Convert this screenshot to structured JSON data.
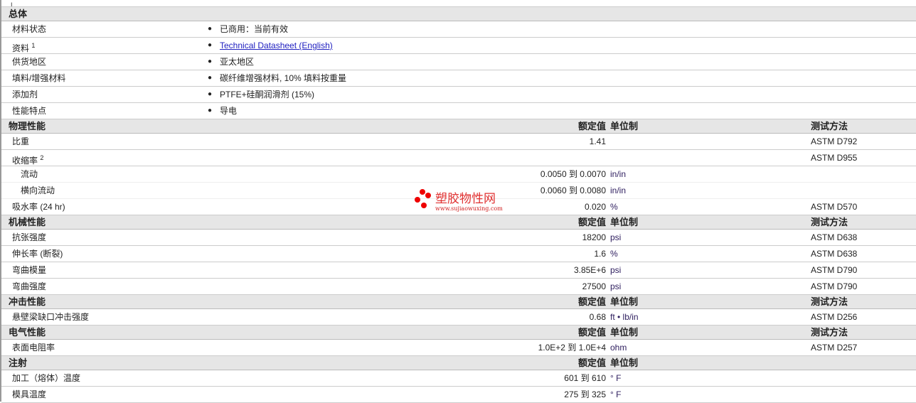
{
  "general": {
    "title": "总体",
    "rows": [
      {
        "label": "材料状态",
        "value": "已商用：当前有效"
      },
      {
        "label": "资料",
        "sup": "1",
        "value": "Technical Datasheet (English)",
        "link": true
      },
      {
        "label": "供货地区",
        "value": "亚太地区"
      },
      {
        "label": "填料/增强材料",
        "value": "碳纤维增强材料, 10% 填料按重量"
      },
      {
        "label": "添加剂",
        "value": "PTFE+硅酮润滑剂 (15%)"
      },
      {
        "label": "性能特点",
        "value": "导电"
      }
    ]
  },
  "headers": {
    "value": "额定值",
    "unit": "单位制",
    "test": "测试方法"
  },
  "sections": [
    {
      "title": "物理性能",
      "show_test": true,
      "rows": [
        {
          "label": "比重",
          "value": "1.41",
          "unit": "",
          "test": "ASTM D792"
        },
        {
          "label": "收缩率",
          "sup": "2",
          "value": "",
          "unit": "",
          "test": "ASTM D955"
        },
        {
          "label": "流动",
          "sub": true,
          "value": "0.0050 到  0.0070",
          "unit": "in/in",
          "test": ""
        },
        {
          "label": "横向流动",
          "sub": true,
          "value": "0.0060 到  0.0080",
          "unit": "in/in",
          "test": ""
        },
        {
          "label": "吸水率 (24 hr)",
          "value": "0.020",
          "unit": "%",
          "test": "ASTM D570"
        }
      ]
    },
    {
      "title": "机械性能",
      "show_test": true,
      "rows": [
        {
          "label": "抗张强度",
          "value": "18200",
          "unit": "psi",
          "test": "ASTM D638"
        },
        {
          "label": "伸长率 (断裂)",
          "value": "1.6",
          "unit": "%",
          "test": "ASTM D638"
        },
        {
          "label": "弯曲模量",
          "value": "3.85E+6",
          "unit": "psi",
          "test": "ASTM D790"
        },
        {
          "label": "弯曲强度",
          "value": "27500",
          "unit": "psi",
          "test": "ASTM D790"
        }
      ]
    },
    {
      "title": "冲击性能",
      "show_test": true,
      "rows": [
        {
          "label": "悬壁梁缺口冲击强度",
          "value": "0.68",
          "unit": "ft • lb/in",
          "test": "ASTM D256"
        }
      ]
    },
    {
      "title": "电气性能",
      "show_test": true,
      "rows": [
        {
          "label": "表面电阻率",
          "value": "1.0E+2 到  1.0E+4",
          "unit": "ohm",
          "test": "ASTM D257"
        }
      ]
    },
    {
      "title": "注射",
      "show_test": false,
      "rows": [
        {
          "label": "加工（熔体）温度",
          "value": "601 到  610",
          "unit": "° F",
          "test": ""
        },
        {
          "label": "模具温度",
          "value": "275 到  325",
          "unit": "° F",
          "test": ""
        }
      ]
    }
  ],
  "watermark": {
    "name": "塑胶物性网",
    "url": "www.sujiaowuxing.com"
  }
}
